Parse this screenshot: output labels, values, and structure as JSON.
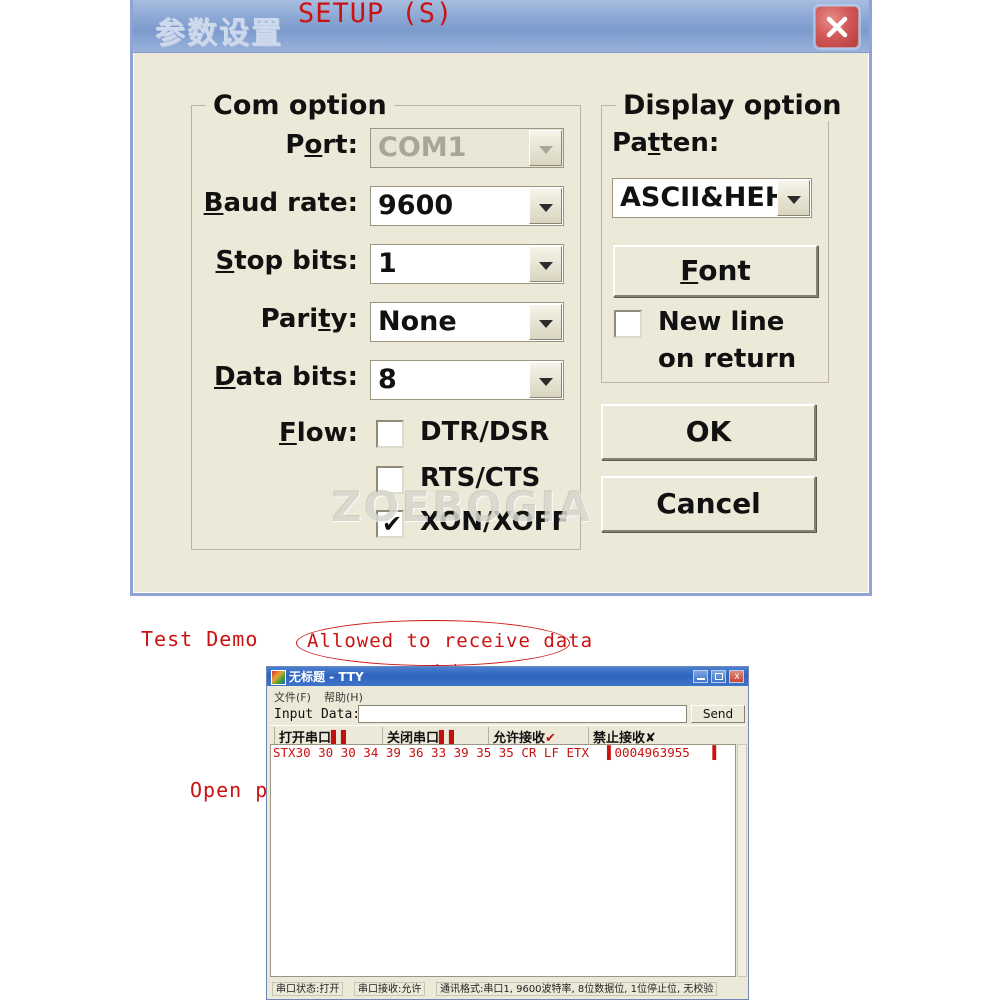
{
  "setup_dialog": {
    "title": "参数设置",
    "close_label": "close-icon",
    "com_group": {
      "legend": "Com option",
      "fields": [
        {
          "label_pre": "P",
          "label_accel": "o",
          "label_post": "rt:",
          "value": "COM1",
          "disabled": true
        },
        {
          "label_pre": "",
          "label_accel": "B",
          "label_post": "aud rate:",
          "value": "9600",
          "disabled": false
        },
        {
          "label_pre": "",
          "label_accel": "S",
          "label_post": "top bits:",
          "value": "1",
          "disabled": false
        },
        {
          "label_pre": "Pari",
          "label_accel": "t",
          "label_post": "y:",
          "value": "None",
          "disabled": false
        },
        {
          "label_pre": "",
          "label_accel": "D",
          "label_post": "ata bits:",
          "value": "8",
          "disabled": false
        }
      ],
      "flow_label_pre": "",
      "flow_label_accel": "F",
      "flow_label_post": "low:",
      "flow_options": [
        {
          "label": "DTR/DSR",
          "checked": false
        },
        {
          "label": "RTS/CTS",
          "checked": false
        },
        {
          "label": "XON/XOFF",
          "checked": true
        }
      ],
      "check_glyph": "✔"
    },
    "display_group": {
      "legend": "Display option",
      "patten_label_pre": "Pa",
      "patten_label_accel": "t",
      "patten_label_post": "ten:",
      "patten_value": "ASCII&HEH",
      "font_button_pre": "",
      "font_button_accel": "F",
      "font_button_post": "ont",
      "newline_label_line1": "New line",
      "newline_label_line2": "on return",
      "newline_checked": false
    },
    "ok_label": "OK",
    "cancel_label": "Cancel",
    "watermark": "ZOEBOGIA"
  },
  "annotations": {
    "setup": "SETUP (S)",
    "test_demo": "Test Demo",
    "allowed": "Allowed to receive data",
    "open_ports": "Open ports",
    "close_ports": "Close ports",
    "accent_color": "#cc1111"
  },
  "tty_window": {
    "title": "无标题 - TTY",
    "window_buttons": {
      "minimize": "minimize-icon",
      "maximize": "maximize-icon",
      "close": "close-icon",
      "close_glyph": "x"
    },
    "menus": [
      "文件(F)",
      "帮助(H)"
    ],
    "input_label": "Input Data:",
    "input_value": "",
    "input_placeholder": "",
    "send_label": "Send",
    "toolbar": [
      {
        "label": "打开串口",
        "icon": "▌▌"
      },
      {
        "label": "关闭串口",
        "icon": "▌▌"
      },
      {
        "label": "允许接收",
        "icon": "✔"
      },
      {
        "label": "禁止接收",
        "icon": "✘"
      }
    ],
    "terminal_line": "STX30 30 30 34 39 36 33 39 35 35 CR LF ETX",
    "terminal_line_right": "▌0004963955   ▌",
    "status": [
      "串口状态:打开",
      "串口接收:允许",
      "通讯格式:串口1, 9600波特率, 8位数据位, 1位停止位, 无校验"
    ]
  }
}
